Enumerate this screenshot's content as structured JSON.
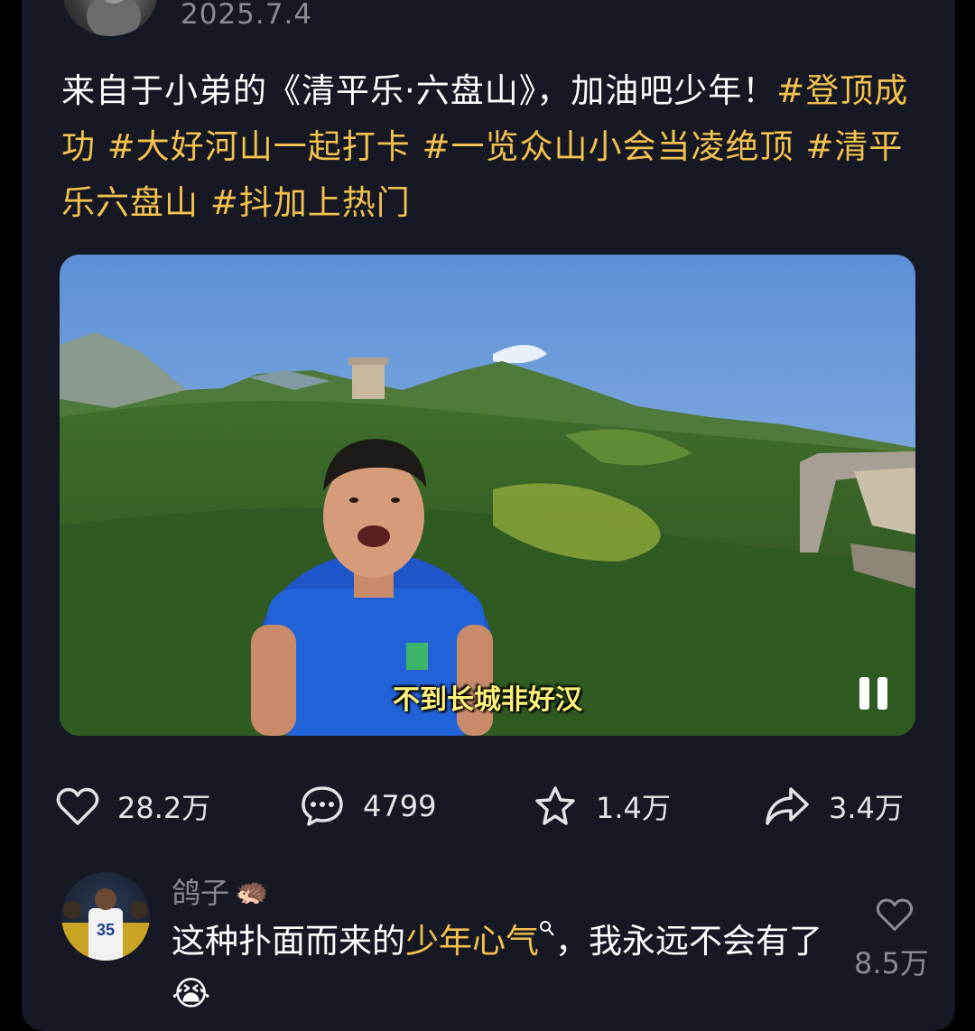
{
  "post": {
    "date": "2025.7.4",
    "caption_text": "来自于小弟的《清平乐·六盘山》，加油吧少年！",
    "hashtags": [
      "#登顶成功",
      "#大好河山一起打卡",
      "#一览众山小会当凌绝顶",
      "#清平乐六盘山",
      "#抖加上热门"
    ]
  },
  "video": {
    "subtitle": "不到长城非好汉",
    "state": "playing"
  },
  "actions": {
    "likes": "28.2万",
    "comments": "4799",
    "favorites": "1.4万",
    "shares": "3.4万"
  },
  "comment": {
    "username": "鸽子",
    "badge_emoji": "🦔",
    "text_before": "这种扑面而来的",
    "highlight": "少年心气",
    "text_after": "，我永远不会有了",
    "emoji": "😭",
    "likes": "8.5万"
  },
  "colors": {
    "background": "#161823",
    "hashtag": "#f2c14e",
    "muted": "#8a8b91"
  }
}
